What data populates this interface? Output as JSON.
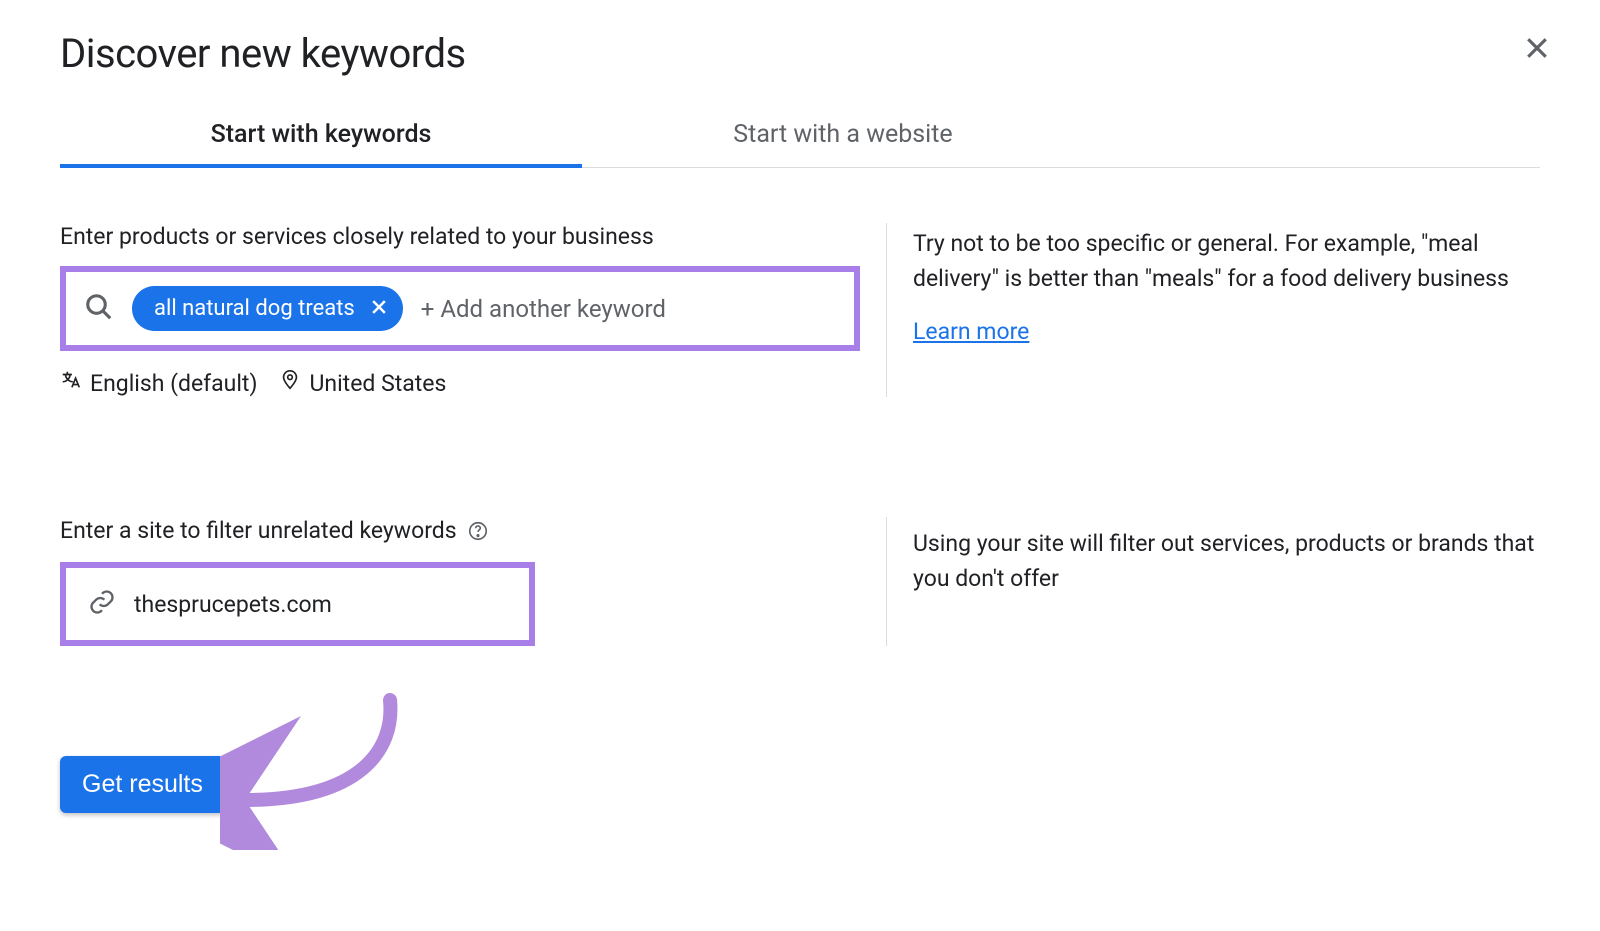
{
  "header": {
    "title": "Discover new keywords"
  },
  "tabs": {
    "keywords": "Start with keywords",
    "website": "Start with a website"
  },
  "keywords_section": {
    "label": "Enter products or services closely related to your business",
    "chip": "all natural dog treats",
    "add_placeholder": "+ Add another keyword",
    "language_label": "English (default)",
    "location_label": "United States",
    "help_text": "Try not to be too specific or general. For example, \"meal delivery\" is better than \"meals\" for a food delivery business",
    "learn_more": "Learn more"
  },
  "site_section": {
    "label": "Enter a site to filter unrelated keywords",
    "value": "thesprucepets.com",
    "help_text": "Using your site will filter out services, products or brands that you don't offer"
  },
  "actions": {
    "get_results": "Get results"
  }
}
